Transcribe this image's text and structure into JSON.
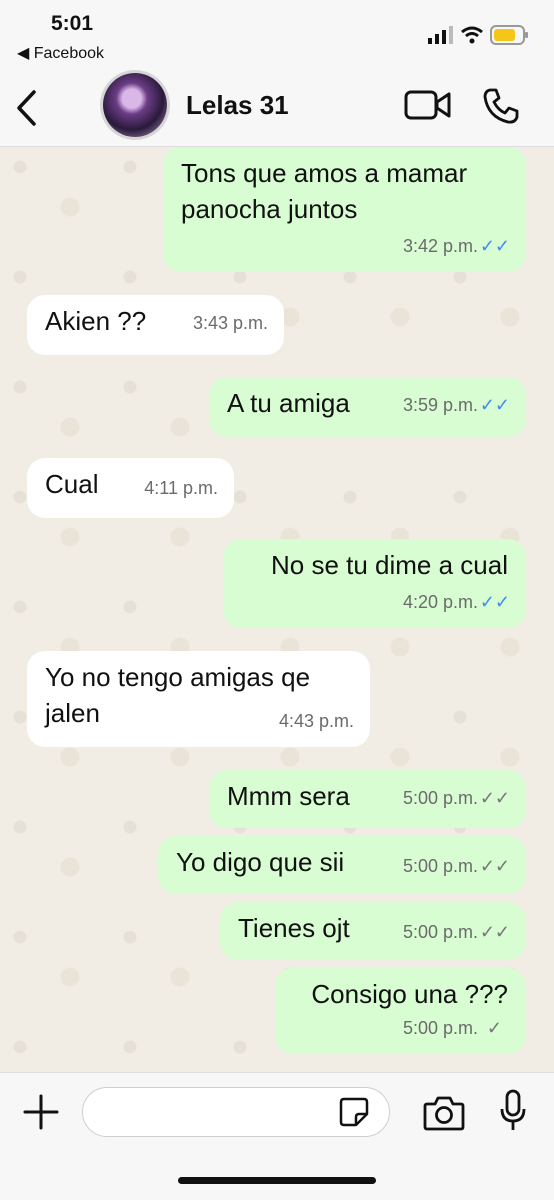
{
  "status": {
    "time": "5:01",
    "back_app": "◀ Facebook"
  },
  "contact": {
    "name": "Lelas 31"
  },
  "messages": [
    {
      "dir": "out",
      "text": "Tons que amos a mamar panocha juntos",
      "time": "3:42 p.m.",
      "status": "read"
    },
    {
      "dir": "in",
      "text": "Akien ??",
      "time": "3:43 p.m."
    },
    {
      "dir": "out",
      "text": "A tu amiga",
      "time": "3:59 p.m.",
      "status": "read"
    },
    {
      "dir": "in",
      "text": "Cual",
      "time": "4:11 p.m."
    },
    {
      "dir": "out",
      "text": "No se tu dime a cual",
      "time": "4:20 p.m.",
      "status": "read"
    },
    {
      "dir": "in",
      "text": "Yo no tengo amigas qe jalen",
      "time": "4:43 p.m."
    },
    {
      "dir": "out",
      "text": "Mmm sera",
      "time": "5:00 p.m.",
      "status": "delivered"
    },
    {
      "dir": "out",
      "text": "Yo digo que sii",
      "time": "5:00 p.m.",
      "status": "delivered"
    },
    {
      "dir": "out",
      "text": "Tienes ojt",
      "time": "5:00 p.m.",
      "status": "delivered"
    },
    {
      "dir": "out",
      "text": "Consigo una ???",
      "time": "5:00 p.m.",
      "status": "sent"
    }
  ],
  "icons": {
    "back": "chevron-left-icon",
    "video": "video-camera-icon",
    "call": "phone-icon",
    "plus": "plus-icon",
    "sticker": "sticker-icon",
    "camera": "camera-icon",
    "mic": "microphone-icon"
  },
  "colors": {
    "outgoing_bubble": "#d9fdd3",
    "incoming_bubble": "#ffffff",
    "read_ticks": "#3f8df0",
    "wallpaper": "#f2ede4"
  }
}
